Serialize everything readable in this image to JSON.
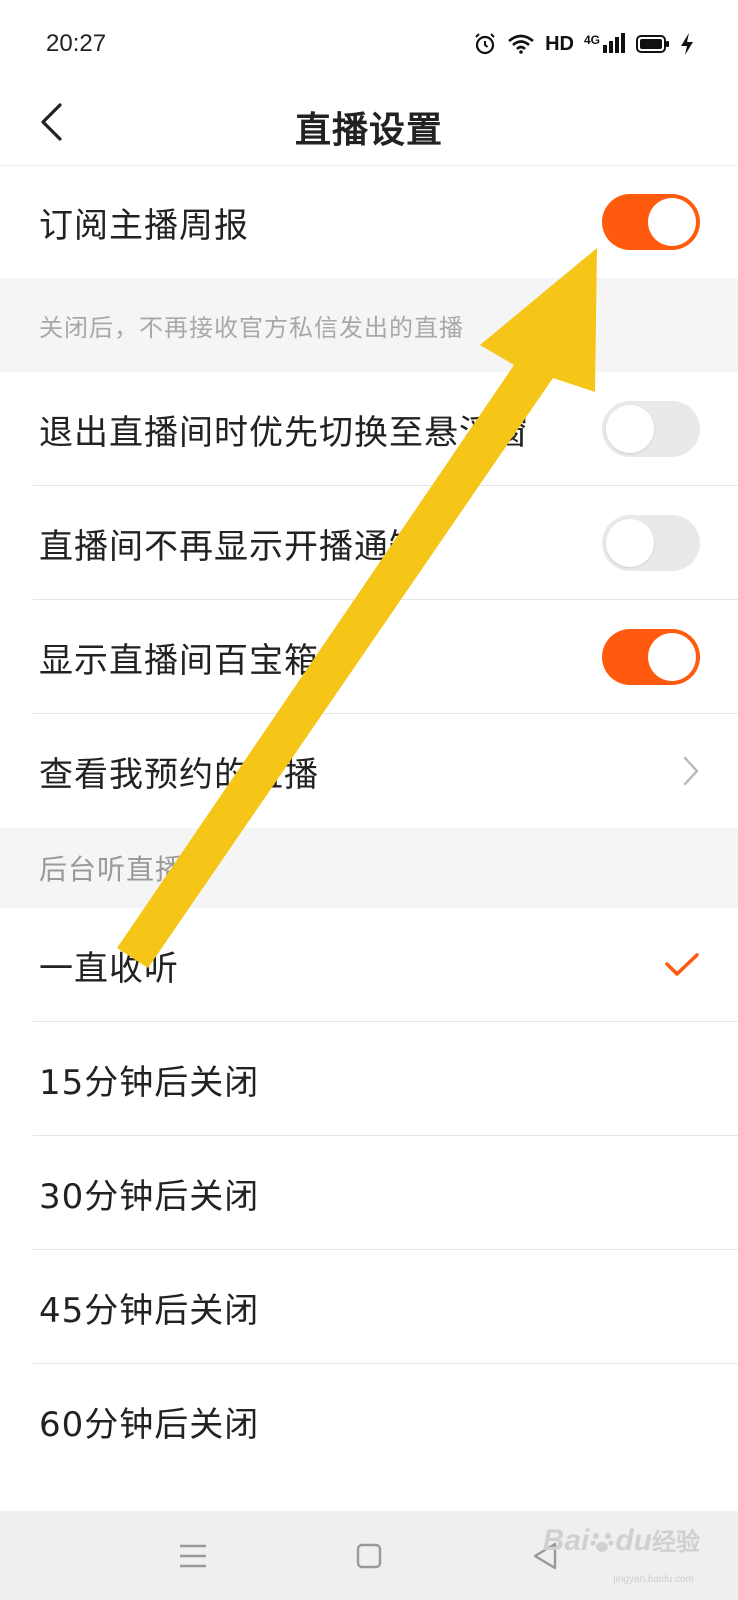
{
  "status_bar": {
    "time": "20:27",
    "hd": "HD",
    "network": "4G",
    "icons": [
      "alarm-icon",
      "wifi-icon",
      "signal-icon",
      "battery-icon",
      "charging-icon"
    ]
  },
  "nav": {
    "title": "直播设置",
    "back_icon": "chevron-left-icon"
  },
  "settings": {
    "subscribe_weekly": {
      "label": "订阅主播周报",
      "enabled": true
    },
    "subscribe_note": "关闭后，不再接收官方私信发出的直播",
    "floating_window": {
      "label": "退出直播间时优先切换至悬浮窗",
      "enabled": false
    },
    "hide_start_notice": {
      "label": "直播间不再显示开播通知",
      "enabled": false
    },
    "show_treasure_box": {
      "label": "显示直播间百宝箱",
      "enabled": true
    },
    "my_reservations": {
      "label": "查看我预约的直播",
      "icon": "chevron-right-icon"
    }
  },
  "background_listening": {
    "header": "后台听直播",
    "options": [
      {
        "label": "一直收听",
        "selected": true
      },
      {
        "label": "15分钟后关闭",
        "selected": false
      },
      {
        "label": "30分钟后关闭",
        "selected": false
      },
      {
        "label": "45分钟后关闭",
        "selected": false
      },
      {
        "label": "60分钟后关闭",
        "selected": false
      }
    ]
  },
  "bottom_nav": {
    "icons": [
      "menu-icon",
      "home-square-icon",
      "back-triangle-icon"
    ]
  },
  "watermark": {
    "brand": "Bai",
    "brand_suffix": "du",
    "brand_cn": "经验",
    "url": "jingyan.baidu.com"
  },
  "colors": {
    "accent": "#ff5a0d",
    "arrow": "#f5c518",
    "toggle_off": "#e9e9e9",
    "section_bg": "#f5f5f5"
  }
}
